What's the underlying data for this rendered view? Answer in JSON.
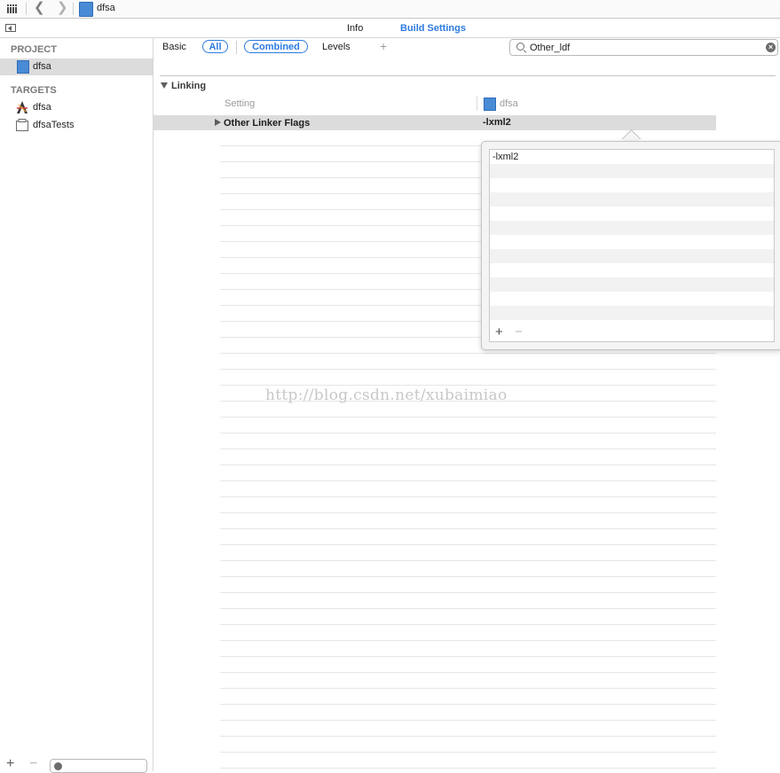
{
  "jumpbar": {
    "file_name": "dfsa"
  },
  "tabs": {
    "info": "Info",
    "build_settings": "Build Settings"
  },
  "outline": {
    "project_header": "PROJECT",
    "project_item": "dfsa",
    "targets_header": "TARGETS",
    "targets": [
      {
        "label": "dfsa",
        "icon": "app-target-icon"
      },
      {
        "label": "dfsaTests",
        "icon": "test-bundle-icon"
      }
    ]
  },
  "filters": {
    "basic": "Basic",
    "all": "All",
    "combined": "Combined",
    "levels": "Levels",
    "add": "+"
  },
  "search": {
    "value": "Other_ldf",
    "clear": "×"
  },
  "section": {
    "title": "Linking",
    "col_setting": "Setting",
    "col_target": "dfsa",
    "row": {
      "name": "Other Linker Flags",
      "value": "-lxml2"
    }
  },
  "popover": {
    "items": [
      "-lxml2"
    ],
    "add": "+",
    "remove": "−"
  },
  "watermark": "http://blog.csdn.net/xubaimiao",
  "bottom": {
    "add": "+",
    "remove": "−"
  },
  "colors": {
    "accent": "#2d7be0",
    "selection": "#dcdcdc"
  }
}
